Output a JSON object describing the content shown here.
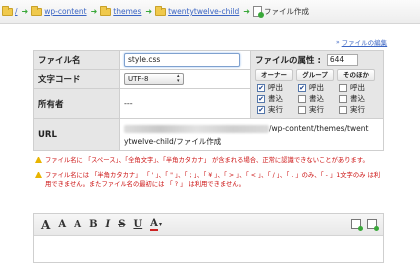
{
  "breadcrumb": {
    "root": "/",
    "items": [
      "wp-content",
      "themes",
      "twentytwelve-child"
    ],
    "current": "ファイル作成"
  },
  "edit_link": "ファイルの編集",
  "form": {
    "filename_label": "ファイル名",
    "filename_value": "style.css",
    "charset_label": "文字コード",
    "charset_value": "UTF-8",
    "owner_label": "所有者",
    "owner_value": "---",
    "url_label": "URL",
    "url_value_line1": "/wp-content/themes/twent",
    "url_value_line2": "ytwelve-child/ファイル作成",
    "attr_label": "ファイルの属性 :",
    "attr_value": "644",
    "perm_heads": [
      "オーナー",
      "グループ",
      "そのほか"
    ],
    "perm_rows": [
      "呼出",
      "書込",
      "実行"
    ],
    "perm_checked": [
      [
        true,
        true,
        false
      ],
      [
        true,
        false,
        false
      ],
      [
        true,
        false,
        false
      ]
    ]
  },
  "warnings": [
    "ファイル名に 「スペース」、「全角文字」、「半角カタカナ」 が含まれる場合、正常に認識できないことがあります。",
    "ファイル名には 「半角カタカナ」 「 ' 」、「 \" 」、「 ; 」、「 ¥ 」、「 > 」、「 < 」、「 / 」、「 . 」のみ、「 - 」1文字のみ は利用できません。またファイル名の最初には 「 ? 」 は利用できません。"
  ],
  "toolbar": {
    "buttons": [
      "A",
      "A",
      "A",
      "B",
      "I",
      "S",
      "U",
      "A"
    ]
  },
  "colors": {
    "link": "#3b65c4",
    "warning": "#cc1111",
    "accent_green": "#3aa83a"
  }
}
